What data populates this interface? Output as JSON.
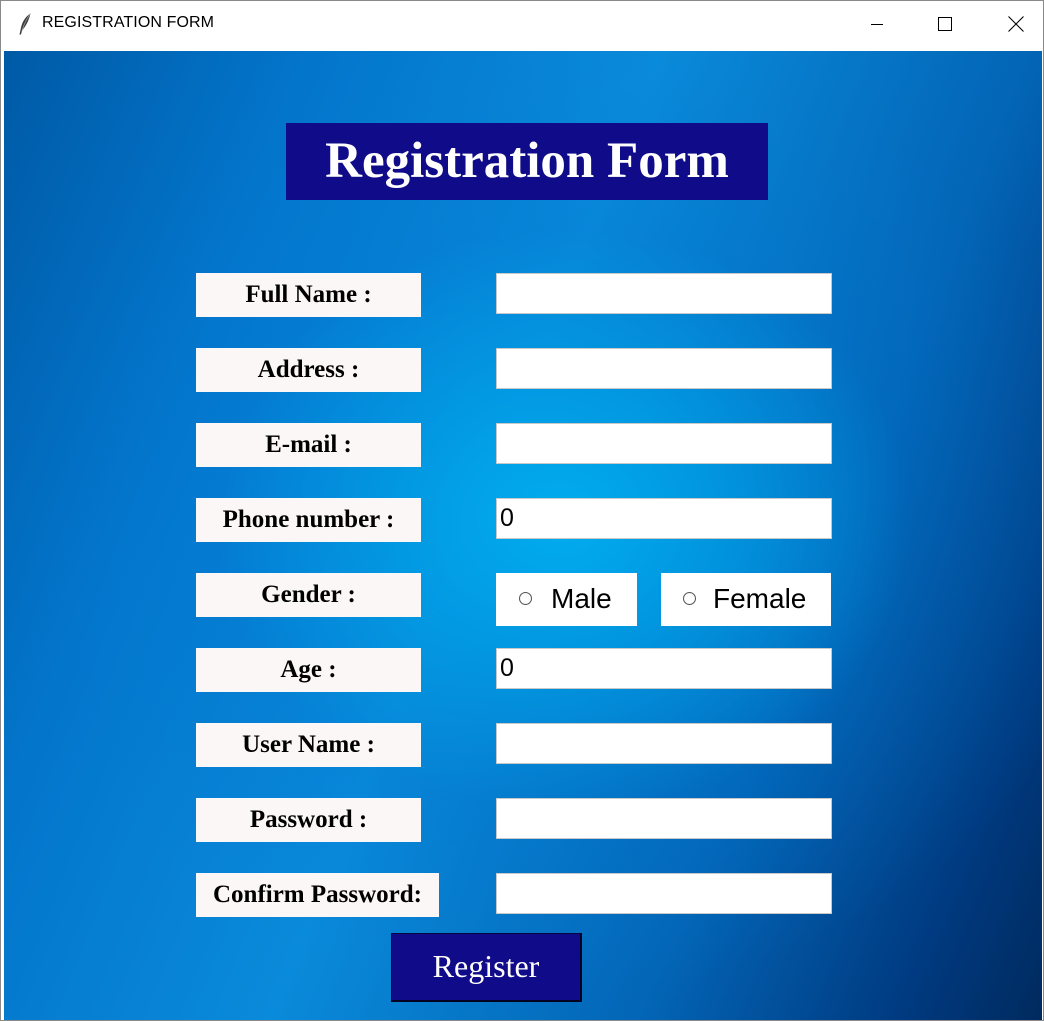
{
  "window": {
    "title": "REGISTRATION FORM",
    "icon": "feather-icon",
    "controls": [
      "minimize-icon",
      "maximize-icon",
      "close-icon"
    ]
  },
  "form": {
    "title": "Registration Form",
    "colors": {
      "title_background": "#100b88",
      "label_background": "#fcf7f7",
      "button_background": "#100b88",
      "window_background": "#0a8ada"
    },
    "fields": {
      "full_name": {
        "label": "Full Name :",
        "value": ""
      },
      "address": {
        "label": "Address :",
        "value": ""
      },
      "email": {
        "label": "E-mail :",
        "value": ""
      },
      "phone": {
        "label": "Phone number :",
        "value": "0"
      },
      "gender": {
        "label": "Gender :",
        "options": [
          "Male",
          "Female"
        ],
        "selected": null
      },
      "age": {
        "label": "Age :",
        "value": "0"
      },
      "username": {
        "label": "User Name :",
        "value": ""
      },
      "password": {
        "label": "Password :",
        "value": ""
      },
      "confirm_password": {
        "label": "Confirm Password:",
        "value": ""
      }
    },
    "register_label": "Register"
  }
}
